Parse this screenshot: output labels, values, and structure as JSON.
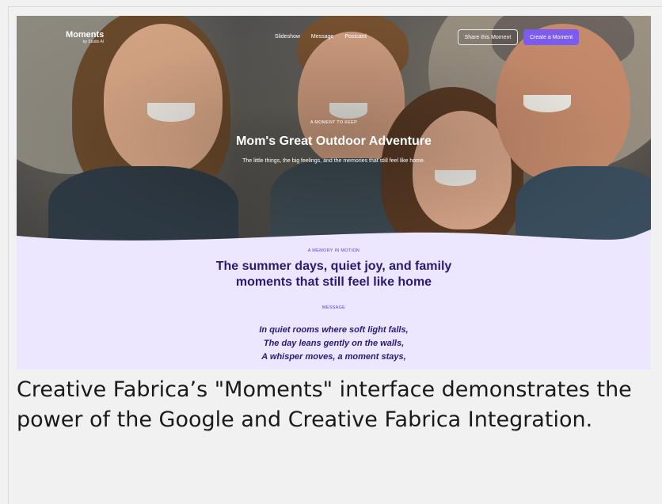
{
  "nav": {
    "brand_name": "Moments",
    "brand_sub": "by Studio AI",
    "links": [
      "Slideshow",
      "Message",
      "Postcard"
    ],
    "share_label": "Share this Moment",
    "create_label": "Create a Moment"
  },
  "hero": {
    "eyebrow": "A MOMENT TO KEEP",
    "title": "Mom's Great Outdoor Adventure",
    "subtitle": "The little things, the big feelings, and the memories that still feel like home."
  },
  "section": {
    "eyebrow": "A MEMORY IN MOTION",
    "title_line1": "The summer days, quiet joy, and family",
    "title_line2": "moments that still feel like home",
    "message_label": "MESSAGE",
    "poem": [
      "In quiet rooms where soft light falls,",
      "The day leans gently on the walls,",
      "A whisper moves, a moment stays,"
    ]
  },
  "caption": "Creative Fabrica’s \"Moments\" interface demonstrates the power of the Google and Creative Fabrica Integration.",
  "colors": {
    "accent": "#7c5cf0",
    "section_bg": "#ece6ff",
    "heading": "#2a1a74",
    "eyebrow": "#5b3fd6"
  }
}
